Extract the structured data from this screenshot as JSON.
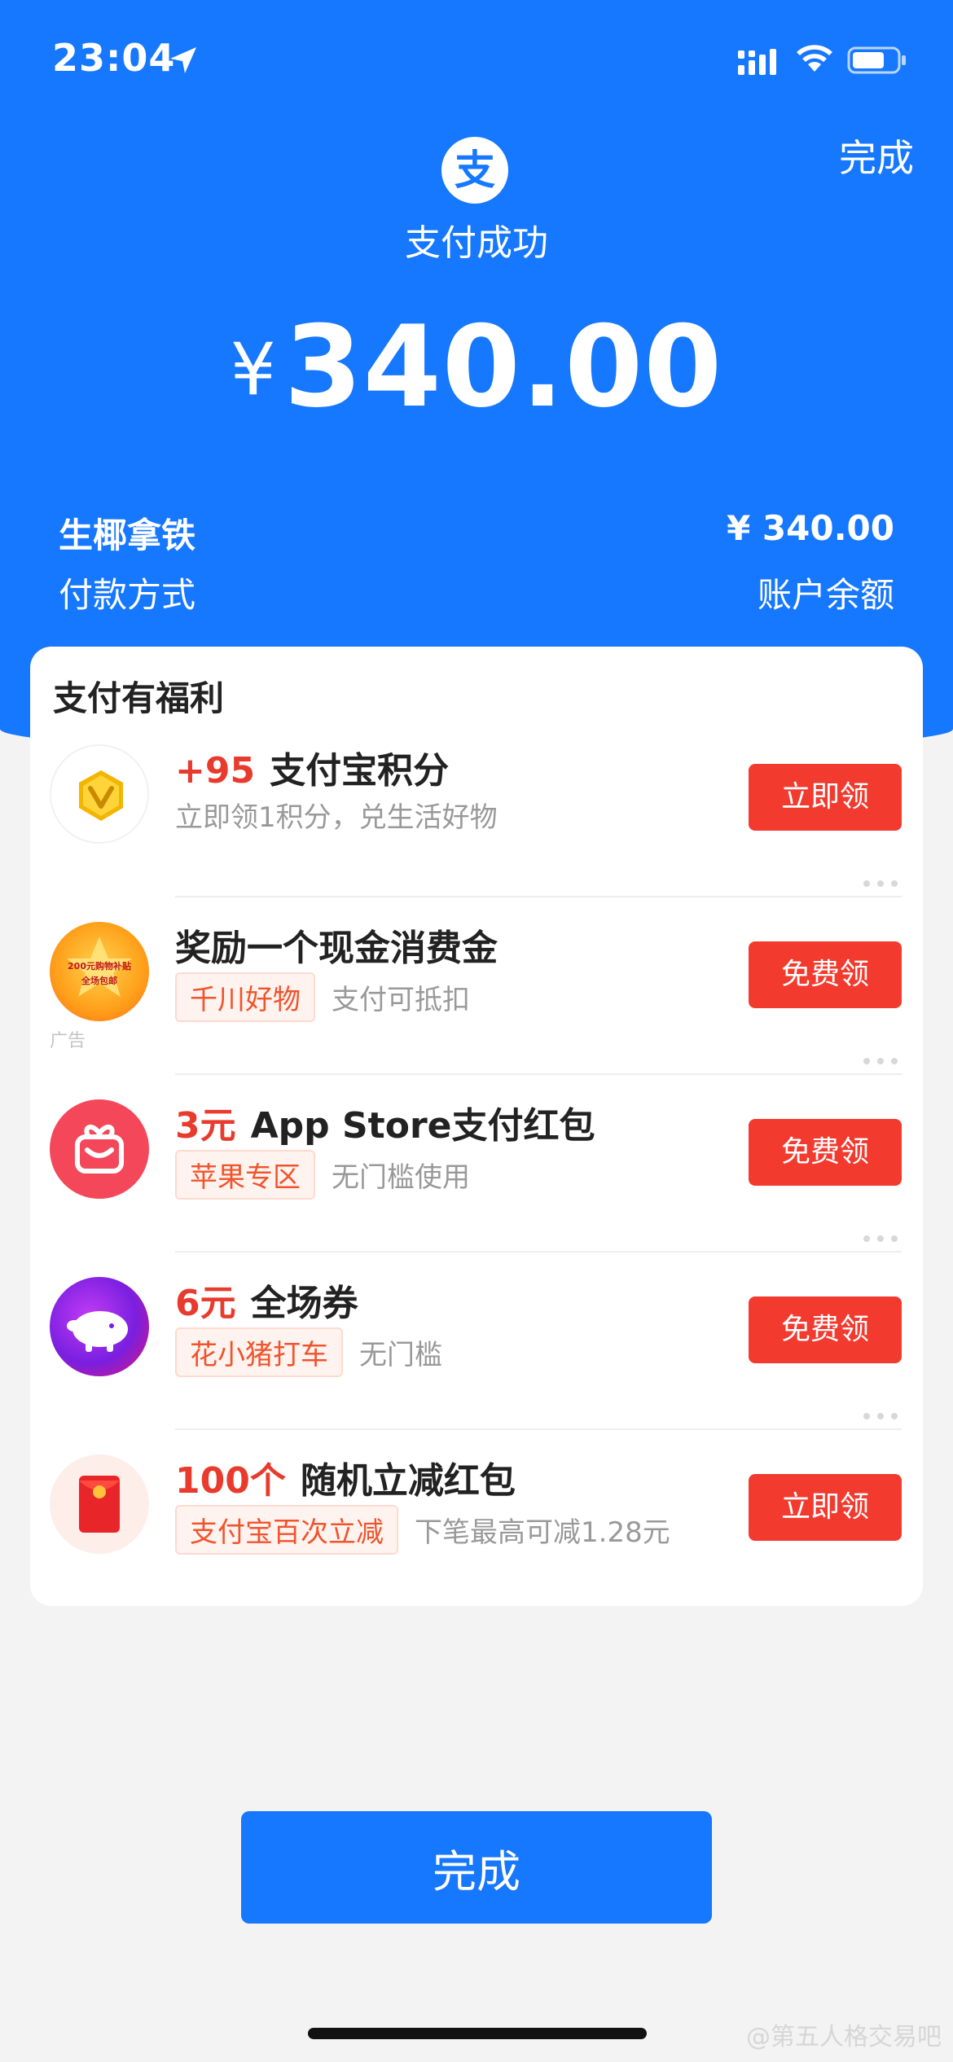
{
  "status_bar": {
    "time": "23:04"
  },
  "header": {
    "done_label": "完成",
    "status_text": "支付成功",
    "currency": "¥",
    "amount": "340.00",
    "merchant_item": "生椰拿铁",
    "payment_amount": "¥ 340.00",
    "payment_method_label": "付款方式",
    "payment_method_value": "账户余额",
    "logo_glyph": "支"
  },
  "benefits": {
    "title": "支付有福利",
    "offers": [
      {
        "highlight": "+95",
        "title": "支付宝积分",
        "tag": "",
        "desc": "立即领1积分，兑生活好物",
        "button": "立即领",
        "icon": "points-coin-icon"
      },
      {
        "highlight": "",
        "title": "奖励一个现金消费金",
        "tag": "千川好物",
        "desc": "支付可抵扣",
        "button": "免费领",
        "icon": "qianchuan-icon",
        "ad_label": "广告",
        "icon_text": "200元购物补贴",
        "icon_text2": "全场包邮"
      },
      {
        "highlight": "3元",
        "title": "App Store支付红包",
        "tag": "苹果专区",
        "desc": "无门槛使用",
        "button": "免费领",
        "icon": "gift-box-icon"
      },
      {
        "highlight": "6元",
        "title": "全场券",
        "tag": "花小猪打车",
        "desc": "无门槛",
        "button": "免费领",
        "icon": "huaxiaozhu-pig-icon"
      },
      {
        "highlight": "100个",
        "title": "随机立减红包",
        "tag": "支付宝百次立减",
        "desc": "下笔最高可减1.28元",
        "button": "立即领",
        "icon": "red-envelope-icon"
      }
    ]
  },
  "footer": {
    "done_button": "完成",
    "watermark": "@第五人格交易吧"
  },
  "colors": {
    "brand_blue": "#1677ff",
    "accent_red": "#f23a2f",
    "tag_orange": "#f0542d"
  }
}
